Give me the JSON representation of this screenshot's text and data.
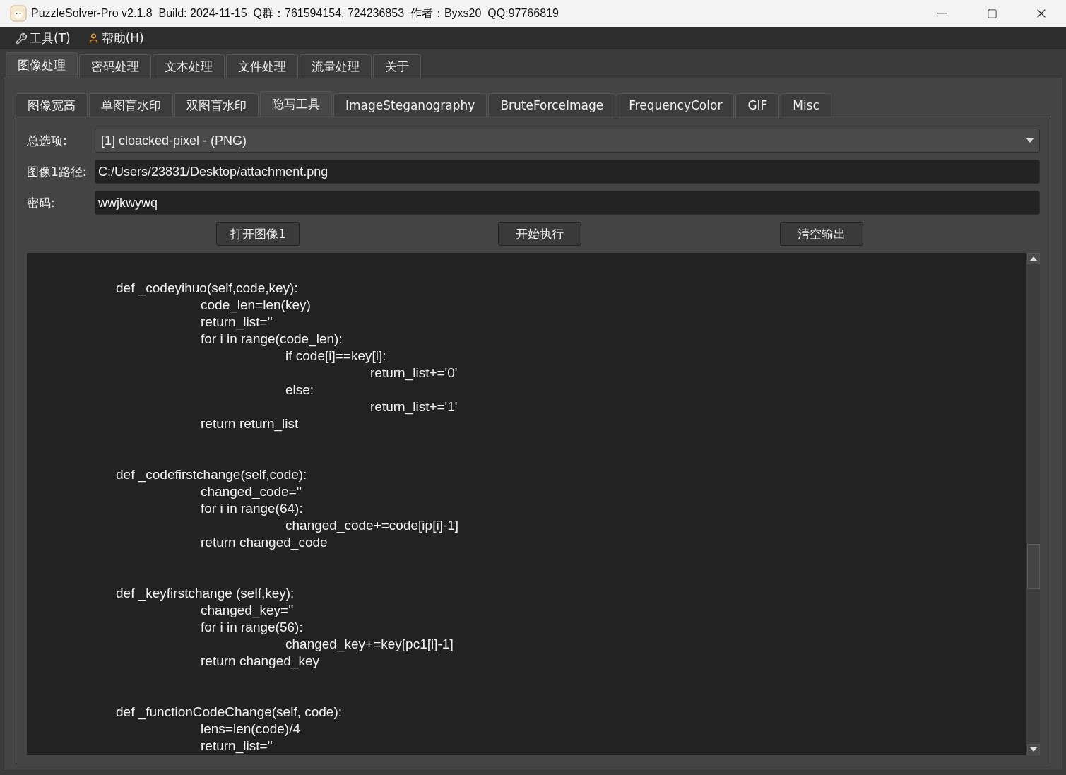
{
  "window": {
    "title": "PuzzleSolver-Pro v2.1.8  Build: 2024-11-15  Q群：761594154, 724236853  作者：Byxs20  QQ:97766819"
  },
  "menu": [
    {
      "label": "工具(T)",
      "kind": "tools"
    },
    {
      "label": "帮助(H)",
      "kind": "help"
    }
  ],
  "tabs": [
    {
      "label": "图像处理",
      "selected": true
    },
    {
      "label": "密码处理",
      "selected": false
    },
    {
      "label": "文本处理",
      "selected": false
    },
    {
      "label": "文件处理",
      "selected": false
    },
    {
      "label": "流量处理",
      "selected": false
    },
    {
      "label": "关于",
      "selected": false
    }
  ],
  "subtabs": [
    {
      "label": "图像宽高",
      "selected": false
    },
    {
      "label": "单图盲水印",
      "selected": false
    },
    {
      "label": "双图盲水印",
      "selected": false
    },
    {
      "label": "隐写工具",
      "selected": true
    },
    {
      "label": "ImageSteganography",
      "selected": false
    },
    {
      "label": "BruteForceImage",
      "selected": false
    },
    {
      "label": "FrequencyColor",
      "selected": false
    },
    {
      "label": "GIF",
      "selected": false
    },
    {
      "label": "Misc",
      "selected": false
    }
  ],
  "form": [
    {
      "label": "总选项:",
      "kind": "select",
      "value": "[1] cloacked-pixel - (PNG)"
    },
    {
      "label": "图像1路径:",
      "kind": "text",
      "value": "C:/Users/23831/Desktop/attachment.png"
    },
    {
      "label": "密码:",
      "kind": "text",
      "value": "wwjkwywq"
    }
  ],
  "buttons": [
    "打开图像1",
    "开始执行",
    "清空输出"
  ],
  "output": [
    {
      "text": "def _codeyihuo(self,code,key):",
      "children": [
        {
          "text": "code_len=len(key)"
        },
        {
          "text": "return_list=''"
        },
        {
          "text": "for i in range(code_len):",
          "children": [
            {
              "text": "if code[i]==key[i]:",
              "children": [
                {
                  "text": "return_list+='0'"
                }
              ]
            },
            {
              "text": "else:",
              "children": [
                {
                  "text": "return_list+='1'"
                }
              ]
            }
          ]
        },
        {
          "text": "return return_list"
        }
      ]
    },
    {
      "text": "def _codefirstchange(self,code):",
      "children": [
        {
          "text": "changed_code=''"
        },
        {
          "text": "for i in range(64):",
          "children": [
            {
              "text": "changed_code+=code[ip[i]-1]"
            }
          ]
        },
        {
          "text": "return changed_code"
        }
      ]
    },
    {
      "text": "def _keyfirstchange (self,key):",
      "children": [
        {
          "text": "changed_key=''"
        },
        {
          "text": "for i in range(56):",
          "children": [
            {
              "text": "changed_key+=key[pc1[i]-1]"
            }
          ]
        },
        {
          "text": "return changed_key"
        }
      ]
    },
    {
      "text": "def _functionCodeChange(self, code):",
      "children": [
        {
          "text": "lens=len(code)/4"
        },
        {
          "text": "return_list=''"
        }
      ]
    }
  ]
}
